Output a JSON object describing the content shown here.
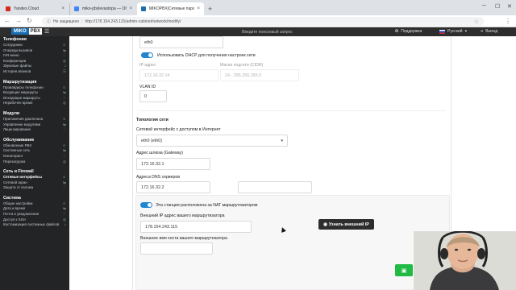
{
  "browser": {
    "tabs": [
      {
        "title": "Yandex.Cloud",
        "color": "#d52b1e"
      },
      {
        "title": "miko-pbxlevastopa — Обор",
        "color": "#4285f4"
      },
      {
        "title": "MIKOPBX|Сетевые параметры",
        "color": "#1b6fb0"
      }
    ],
    "security_label": "Не защищено",
    "url": "http://178.154.243.115/admin-cabinet/network/modify/"
  },
  "app": {
    "logo_main": "MIKO",
    "logo_sub": "PBX",
    "search_placeholder": "Введите поисковый запрос",
    "support_label": "Поддержка",
    "language_label": "Русский",
    "logout_label": "Выход"
  },
  "sidebar": {
    "sections": [
      {
        "title": "Телефония",
        "items": [
          "Сотрудники",
          "Очереди вызовов",
          "IVR меню",
          "Конференции",
          "Звуковые файлы",
          "История звонков"
        ]
      },
      {
        "title": "Маршрутизация",
        "items": [
          "Провайдеры телефонии",
          "Входящие маршруты",
          "Исходящие маршруты",
          "Нерабочее время"
        ]
      },
      {
        "title": "Модули",
        "items": [
          "Приложения диалплана",
          "Управление модулями",
          "Лицензирование"
        ]
      },
      {
        "title": "Обслуживание",
        "items": [
          "Обновление PBX",
          "Системные сеть",
          "Мониторинг",
          "Перезагрузка"
        ]
      },
      {
        "title": "Сеть и Firewall",
        "items": [
          "Сетевые интерфейсы",
          "Сетевой экран",
          "Защита от взлома"
        ]
      },
      {
        "title": "Система",
        "items": [
          "Общие настройки",
          "Дата и время",
          "Почта и уведомления",
          "Доступ к SSH",
          "Кастомизация системных файлов"
        ]
      }
    ]
  },
  "form": {
    "interface_value": "eth0",
    "dhcp_label": "Использовать DHCP для получения настроек сети",
    "ip_label": "IP адрес",
    "ip_value": "172.16.32.14",
    "mask_label": "Маска подсети (CIDR)",
    "mask_value": "24 - 255.255.255.0",
    "vlan_label": "VLAN ID",
    "vlan_value": "0",
    "topology_title": "Топология сети",
    "internet_iface_label": "Сетевой интерфейс с доступом в Интернет",
    "internet_iface_value": "eth0 (eth0)",
    "gateway_label": "Адрес шлюза (Gateway)",
    "gateway_value": "172.16.32.1",
    "dns_label": "Адреса DNS серверов",
    "dns1_value": "172.16.32.2",
    "dns2_value": "",
    "nat_label": "Эта станция расположена за NAT маршрутизатором",
    "ext_ip_label": "Внешний IP адрес вашего маршрутизатора",
    "ext_ip_value": "178.154.243.115",
    "get_ip_button": "Узнать внешний IP",
    "ext_host_label": "Внешнее имя хоста вашего маршрутизатора",
    "ext_host_value": ""
  },
  "colors": {
    "accent": "#2185d0",
    "save": "#21ba45",
    "sidebar_bg": "#222426"
  }
}
